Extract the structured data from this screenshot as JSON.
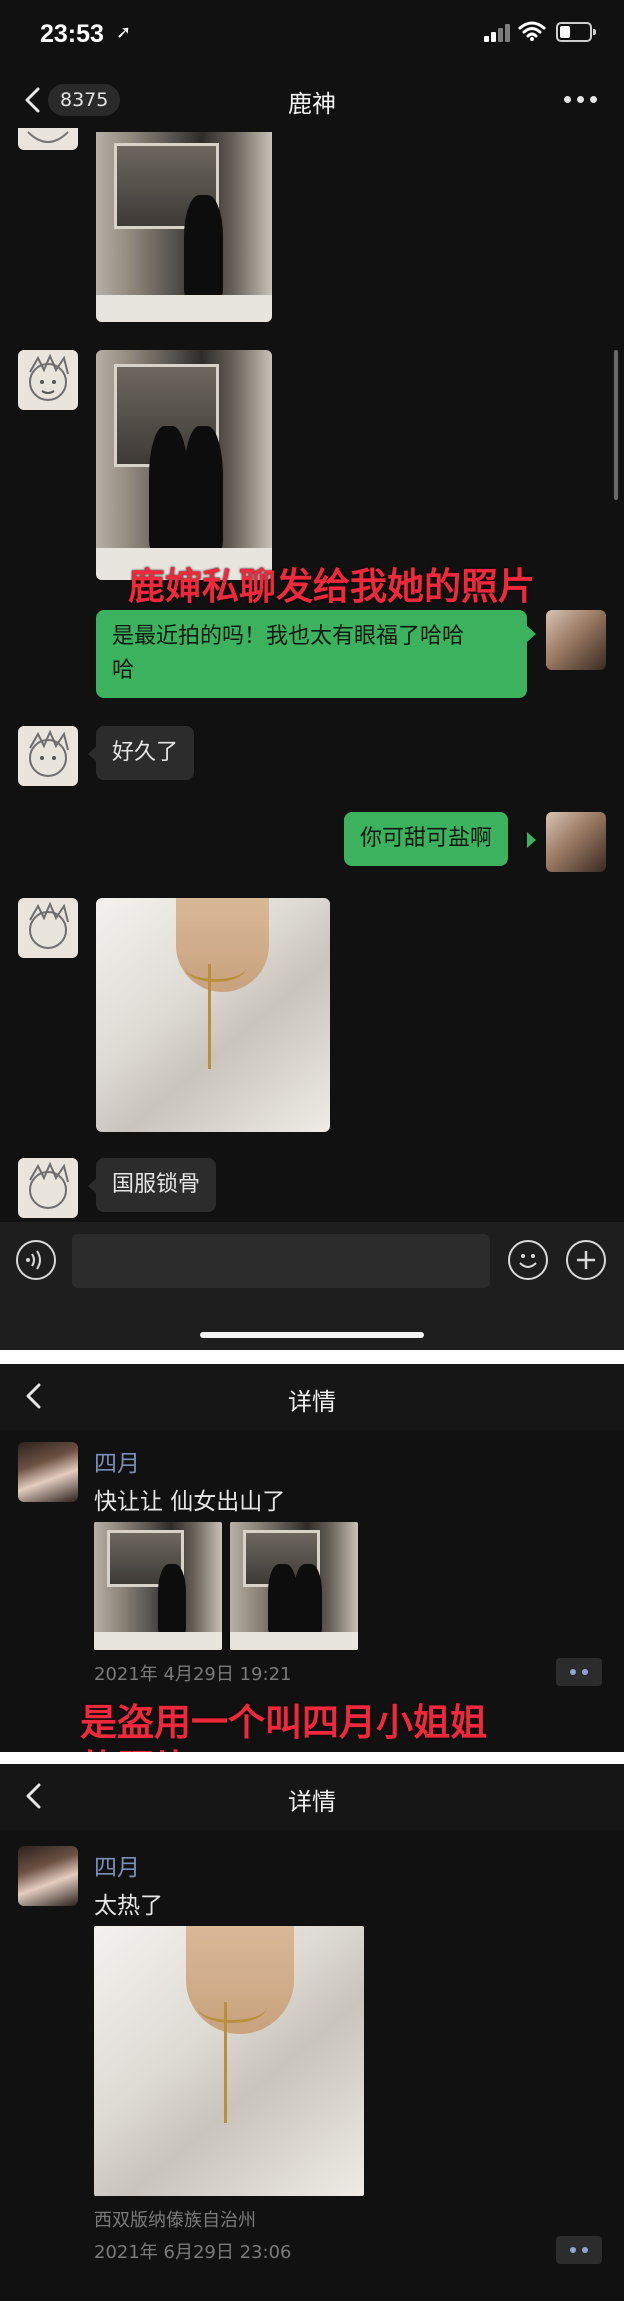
{
  "status_bar": {
    "time": "23:53",
    "location_glyph": "➚"
  },
  "chat_header": {
    "unread_count": "8375",
    "title": "鹿神"
  },
  "messages": [
    {
      "type": "image",
      "from": "other",
      "content": "mirror-selfie-bathroom"
    },
    {
      "type": "image",
      "from": "other",
      "content": "two-women-bathroom-mirror"
    },
    {
      "type": "text",
      "from": "me",
      "text": "是最近拍的吗！我也太有眼福了哈哈\n哈"
    },
    {
      "type": "text",
      "from": "other",
      "text": "好久了"
    },
    {
      "type": "text",
      "from": "me",
      "text": "你可甜可盐啊"
    },
    {
      "type": "image",
      "from": "other",
      "content": "white-shirt-necklace"
    },
    {
      "type": "text",
      "from": "other",
      "text": "国服锁骨"
    }
  ],
  "annotations": {
    "caption1": "鹿婶私聊发给我她的照片",
    "caption2": "是盗用一个叫四月小姐姐\n的照片"
  },
  "moment_detail_1": {
    "nav_title": "详情",
    "author": "四月",
    "text": "快让让 仙女出山了",
    "photos": [
      "bathroom-photo-1",
      "bathroom-photo-2"
    ],
    "timestamp": "2021年 4月29日 19:21"
  },
  "moment_detail_2": {
    "nav_title": "详情",
    "author": "四月",
    "text": "太热了",
    "photos": [
      "white-shirt-necklace"
    ],
    "location": "西双版纳傣族自治州",
    "timestamp": "2021年 6月29日 23:06"
  },
  "colors": {
    "background": "#111111",
    "bubble_out": "#3cb25f",
    "bubble_in": "#2c2c2c",
    "author_name": "#7a8fb8",
    "annotation_red": "#f0283c"
  }
}
